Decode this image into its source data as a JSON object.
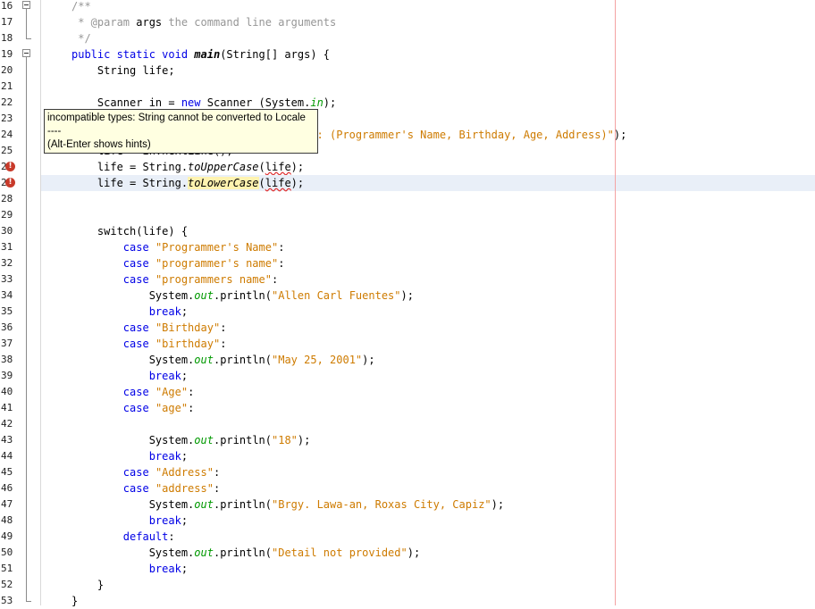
{
  "editor": {
    "lines": [
      {
        "n": "16",
        "html": "<span class=\"cm\">/**</span>"
      },
      {
        "n": "17",
        "html": "<span class=\"cm\"> * @param </span><span>args</span><span class=\"cm\"> the command line arguments</span>"
      },
      {
        "n": "18",
        "html": "<span class=\"cm\"> */</span>"
      },
      {
        "n": "19",
        "html": "<span class=\"kw\">public static void </span><span class=\"it bold\">main</span>(String[] args) {"
      },
      {
        "n": "20",
        "html": "    String life;"
      },
      {
        "n": "21",
        "html": ""
      },
      {
        "n": "22",
        "html": "    Scanner in = <span class=\"kw\">new</span> Scanner (System.<span class=\"fld\">in</span>);"
      },
      {
        "n": "23",
        "html": ""
      },
      {
        "n": "24",
        "html": "                                   <span class=\"str\">ail: (Programmer's Name, Birthday, Age, Address)\"</span>);"
      },
      {
        "n": "25",
        "html": "    life = in.nextLine();"
      },
      {
        "n": "26",
        "html": "    life = String.<span class=\"it\">toUpperCase</span>(<span class=\"squig\">life</span>);"
      },
      {
        "n": "27",
        "html": "    life = String.<span class=\"it hlbox\">toLowerCase</span>(<span class=\"squig\">life</span>);"
      },
      {
        "n": "28",
        "html": ""
      },
      {
        "n": "29",
        "html": ""
      },
      {
        "n": "30",
        "html": "    switch(life) {"
      },
      {
        "n": "31",
        "html": "        <span class=\"kw\">case</span> <span class=\"str\">\"Programmer's Name\"</span>:"
      },
      {
        "n": "32",
        "html": "        <span class=\"kw\">case</span> <span class=\"str\">\"programmer's name\"</span>:"
      },
      {
        "n": "33",
        "html": "        <span class=\"kw\">case</span> <span class=\"str\">\"programmers name\"</span>:"
      },
      {
        "n": "34",
        "html": "            System.<span class=\"fld\">out</span>.println(<span class=\"str\">\"Allen Carl Fuentes\"</span>);"
      },
      {
        "n": "35",
        "html": "            <span class=\"kw\">break</span>;"
      },
      {
        "n": "36",
        "html": "        <span class=\"kw\">case</span> <span class=\"str\">\"Birthday\"</span>:"
      },
      {
        "n": "37",
        "html": "        <span class=\"kw\">case</span> <span class=\"str\">\"birthday\"</span>:"
      },
      {
        "n": "38",
        "html": "            System.<span class=\"fld\">out</span>.println(<span class=\"str\">\"May 25, 2001\"</span>);"
      },
      {
        "n": "39",
        "html": "            <span class=\"kw\">break</span>;"
      },
      {
        "n": "40",
        "html": "        <span class=\"kw\">case</span> <span class=\"str\">\"Age\"</span>:"
      },
      {
        "n": "41",
        "html": "        <span class=\"kw\">case</span> <span class=\"str\">\"age\"</span>:"
      },
      {
        "n": "42",
        "html": ""
      },
      {
        "n": "43",
        "html": "            System.<span class=\"fld\">out</span>.println(<span class=\"str\">\"18\"</span>);"
      },
      {
        "n": "44",
        "html": "            <span class=\"kw\">break</span>;"
      },
      {
        "n": "45",
        "html": "        <span class=\"kw\">case</span> <span class=\"str\">\"Address\"</span>:"
      },
      {
        "n": "46",
        "html": "        <span class=\"kw\">case</span> <span class=\"str\">\"address\"</span>:"
      },
      {
        "n": "47",
        "html": "            System.<span class=\"fld\">out</span>.println(<span class=\"str\">\"Brgy. Lawa-an, Roxas City, Capiz\"</span>);"
      },
      {
        "n": "48",
        "html": "            <span class=\"kw\">break</span>;"
      },
      {
        "n": "49",
        "html": "        <span class=\"kw\">default</span>:"
      },
      {
        "n": "50",
        "html": "            System.<span class=\"fld\">out</span>.println(<span class=\"str\">\"Detail not provided\"</span>);"
      },
      {
        "n": "51",
        "html": "            <span class=\"kw\">break</span>;"
      },
      {
        "n": "52",
        "html": "    }"
      },
      {
        "n": "53",
        "html": "}"
      }
    ],
    "error_lines": [
      "26",
      "27"
    ],
    "highlight_line": "27",
    "fold_markers": [
      "16",
      "19"
    ]
  },
  "tooltip": {
    "line1": "incompatible types: String cannot be converted to Locale",
    "line2": "----",
    "line3": "(Alt-Enter shows hints)"
  },
  "colors": {
    "keyword": "#0000e6",
    "string": "#ce7b00",
    "comment": "#969696",
    "error": "#c83a2a",
    "highlight": "#e9eff8",
    "tooltip_bg": "#ffffe1"
  }
}
